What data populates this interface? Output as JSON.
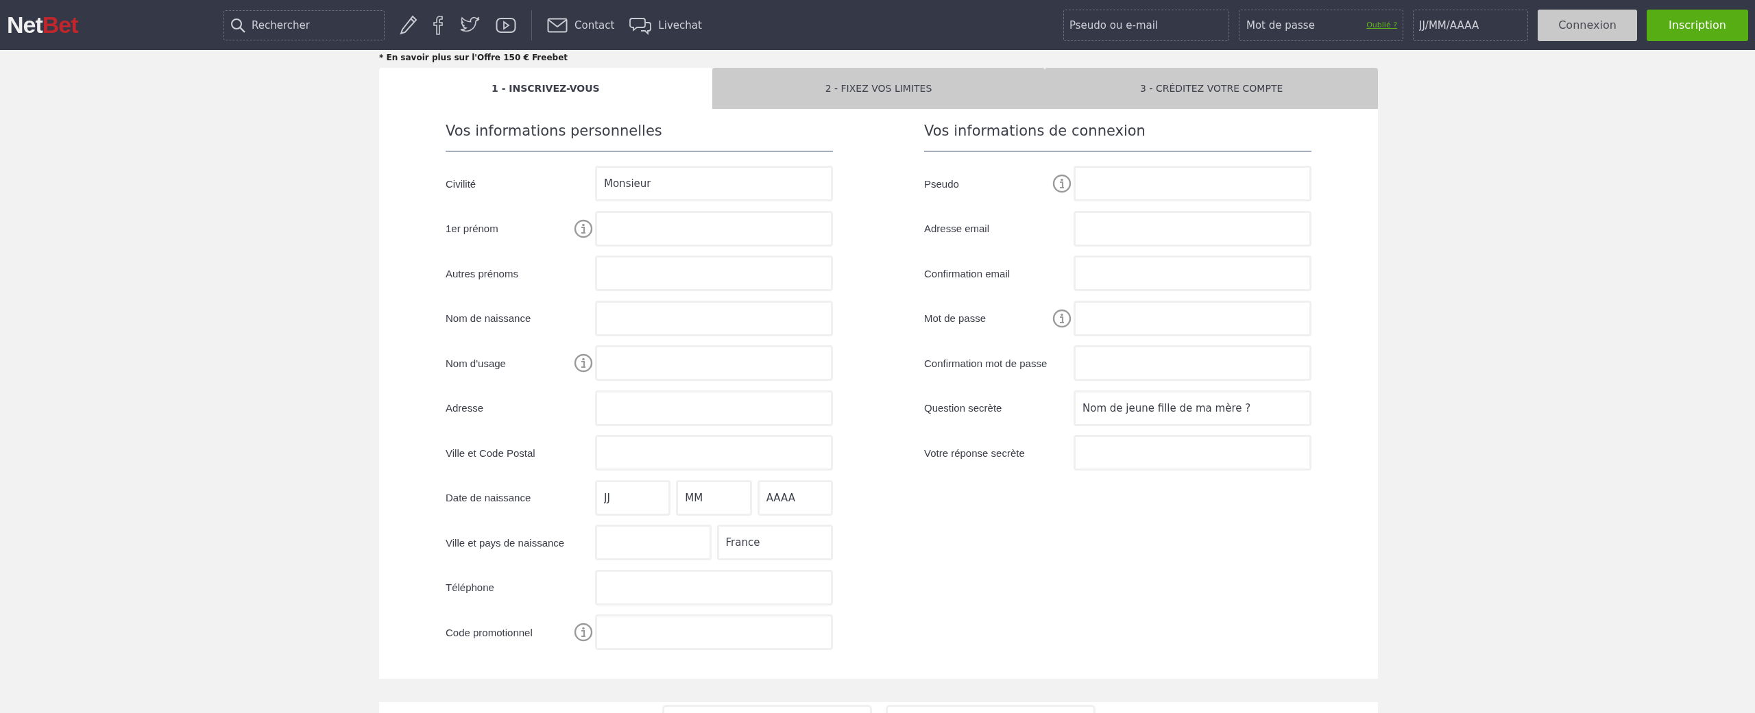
{
  "header": {
    "logo": {
      "part_1": "Net",
      "part_2": "Bet"
    },
    "search": {
      "placeholder": "Rechercher"
    },
    "links": [
      {
        "kind": "mail",
        "label": "Contact"
      },
      {
        "kind": "chat",
        "label": "Livechat"
      }
    ],
    "login": {
      "username": {
        "placeholder": "Pseudo ou e-mail"
      },
      "password": {
        "placeholder": "Mot de passe",
        "forgot_link": "Oublié ?"
      },
      "birthdate": {
        "placeholder": "JJ/MM/AAAA"
      },
      "login_button": "Connexion",
      "register_button": "Inscription"
    }
  },
  "offer_note": "* En savoir plus sur l'Offre 150 € Freebet",
  "steps": [
    {
      "label": "1 - INSCRIVEZ-VOUS",
      "selected": true
    },
    {
      "label": "2 - FIXEZ VOS LIMITES",
      "selected": false
    },
    {
      "label": "3 - CRÉDITEZ VOTRE COMPTE",
      "selected": false
    }
  ],
  "sections": [
    {
      "title": "Vos informations personnelles",
      "fields": [
        {
          "label": "Civilité",
          "info": false,
          "value": "Monsieur"
        },
        {
          "label": "1er prénom",
          "info": true
        },
        {
          "label": "Autres prénoms",
          "info": false
        },
        {
          "label": "Nom de naissance",
          "info": false
        },
        {
          "label": "Nom d'usage",
          "info": true
        },
        {
          "label": "Adresse",
          "info": false
        },
        {
          "label": "Ville et Code Postal",
          "info": false
        },
        {
          "label": "Date de naissance",
          "info": false,
          "placeholder": "JJ",
          "extra_inputs": [
            {
              "placeholder": "MM"
            },
            {
              "placeholder": "AAAA"
            }
          ]
        },
        {
          "label": "Ville et pays de naissance",
          "info": false,
          "extra_inputs": [
            {
              "value": "France"
            }
          ]
        },
        {
          "label": "Téléphone",
          "info": false
        },
        {
          "label": "Code promotionnel",
          "info": true
        }
      ]
    },
    {
      "title": "Vos informations de connexion",
      "fields": [
        {
          "label": "Pseudo",
          "info": true
        },
        {
          "label": "Adresse email",
          "info": false
        },
        {
          "label": "Confirmation email",
          "info": false
        },
        {
          "label": "Mot de passe",
          "info": true
        },
        {
          "label": "Confirmation mot de passe",
          "info": false
        },
        {
          "label": "Question secrète",
          "info": false,
          "value": "Nom de jeune fille de ma mère ?"
        },
        {
          "label": "Votre réponse secrète",
          "info": false
        }
      ]
    }
  ]
}
